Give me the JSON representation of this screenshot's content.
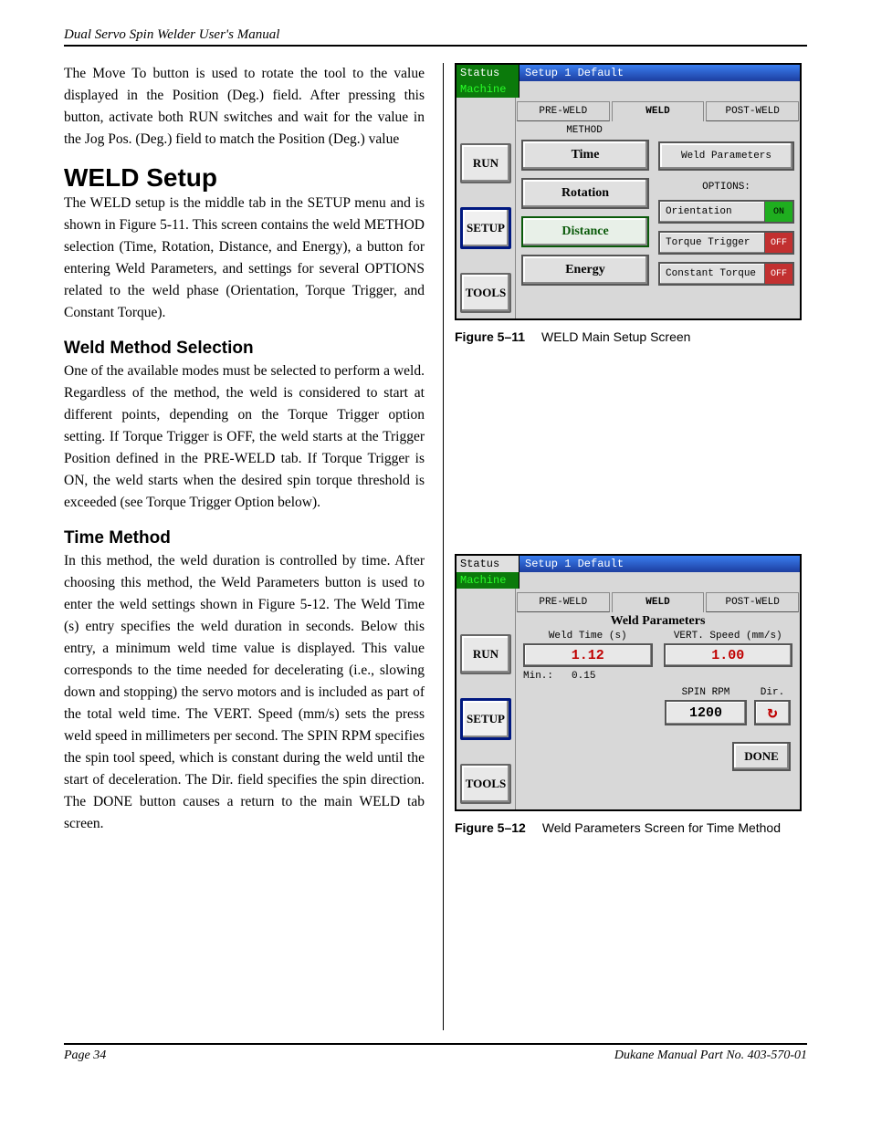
{
  "header": {
    "running": "Dual Servo Spin Welder User's Manual"
  },
  "intro": "The Move To button is used to rotate the tool to the value displayed in the Position (Deg.) field. After pressing this button, activate both RUN switches and wait for the value in the Jog Pos. (Deg.) field to match the Position (Deg.) value",
  "weld_setup": {
    "title": "WELD Setup",
    "para": "The WELD setup is the middle tab in the SETUP menu and is shown in Figure 5-11. This screen contains the weld METHOD selection (Time, Rotation, Distance, and Energy), a button for entering Weld Parameters, and settings for several OPTIONS related to the weld phase (Orientation, Torque Trigger, and Constant Torque)."
  },
  "method_sel": {
    "title": "Weld Method Selection",
    "para": "One of the available modes must be selected to perform a weld. Regardless of the method, the weld is considered to start at different points, depending on the Torque Trigger option setting. If Torque Trigger is OFF, the weld starts at the Trigger Position defined in the PRE-WELD tab. If Torque Trigger is ON, the weld starts when the desired spin torque threshold is exceeded (see Torque Trigger Option below)."
  },
  "time_method": {
    "title": "Time Method",
    "para": "In this method, the weld duration is controlled by time. After choosing this method, the Weld Parameters button is used to enter the weld settings shown in Figure 5-12. The Weld Time (s) entry specifies the weld duration in seconds.  Below this entry, a minimum weld time value is displayed. This value corresponds to the time needed for decelerating (i.e., slowing down and stopping) the servo motors and is included as part of the total weld time. The VERT. Speed (mm/s) sets the press weld speed in millimeters per second. The SPIN RPM specifies the spin tool speed, which is constant during the weld until the start of deceleration. The Dir. field specifies the spin direction. The DONE button causes a return to the main WELD tab screen."
  },
  "fig11": {
    "num": "Figure 5–11",
    "caption": "WELD Main Setup Screen",
    "titlebar_status": "Status",
    "titlebar_rest": "Setup 1   Default",
    "machine": "Machine",
    "nav": {
      "run": "RUN",
      "setup": "SETUP",
      "tools": "TOOLS"
    },
    "tabs": {
      "pre": "PRE-WELD",
      "weld": "WELD",
      "post": "POST-WELD"
    },
    "method_label": "METHOD",
    "methods": {
      "time": "Time",
      "rotation": "Rotation",
      "distance": "Distance",
      "energy": "Energy"
    },
    "wp_button": "Weld Parameters",
    "options_label": "OPTIONS:",
    "opts": {
      "orientation": {
        "label": "Orientation",
        "state": "ON"
      },
      "torque_trigger": {
        "label": "Torque Trigger",
        "state": "OFF"
      },
      "constant_torque": {
        "label": "Constant Torque",
        "state": "OFF"
      }
    }
  },
  "fig12": {
    "num": "Figure 5–12",
    "caption": "Weld Parameters Screen for Time Method",
    "titlebar_status": "Status",
    "titlebar_rest": "Setup 1   Default",
    "machine": "Machine",
    "nav": {
      "run": "RUN",
      "setup": "SETUP",
      "tools": "TOOLS"
    },
    "tabs": {
      "pre": "PRE-WELD",
      "weld": "WELD",
      "post": "POST-WELD"
    },
    "panel_title": "Weld Parameters",
    "weld_time_label": "Weld Time (s)",
    "weld_time_val": "1.12",
    "vert_speed_label": "VERT. Speed (mm/s)",
    "vert_speed_val": "1.00",
    "min_label": "Min.:",
    "min_val": "0.15",
    "spin_rpm_label": "SPIN RPM",
    "spin_rpm_val": "1200",
    "dir_label": "Dir.",
    "done": "DONE"
  },
  "footer": {
    "left": "Page   34",
    "right": "Dukane Manual Part No. 403-570-01"
  }
}
